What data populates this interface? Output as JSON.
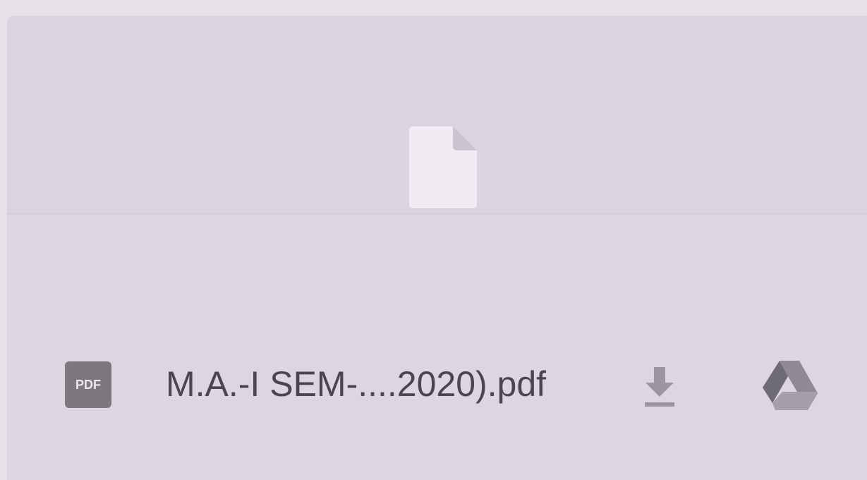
{
  "attachment": {
    "file_type_badge": "PDF",
    "file_name": "M.A.-I SEM-....2020).pdf",
    "icons": {
      "preview": "file-placeholder-icon",
      "type": "pdf-icon",
      "download": "download-icon",
      "save_to_drive": "google-drive-icon"
    }
  }
}
